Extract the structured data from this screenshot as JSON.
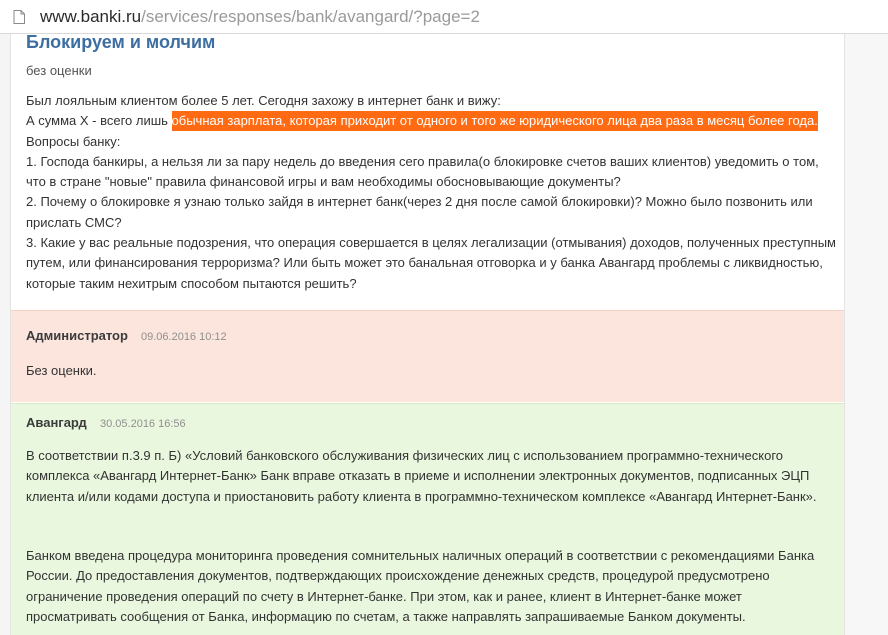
{
  "browser": {
    "url_host": "www.banki.ru",
    "url_path": "/services/responses/bank/avangard/?page=2"
  },
  "review": {
    "title": "Блокируем и молчим",
    "rating": "без оценки",
    "line1": "Был лояльным клиентом более 5 лет. Сегодня захожу в интернет банк и вижу:",
    "line2_pre": "А сумма X - всего лишь ",
    "line2_highlight": "обычная зарплата, которая приходит от одного и того же юридического лица два раза в месяц более года.",
    "line3": "Вопросы банку:",
    "q1": "1. Господа банкиры, а нельзя ли за пару недель до введения сего правила(о блокировке счетов ваших клиентов) уведомить о том, что в стране \"новые\" правила финансовой игры и вам необходимы обосновывающие документы?",
    "q2": "2. Почему о блокировке я узнаю только зайдя в интернет банк(через 2 дня после самой блокировки)? Можно было позвонить или прислать СМС?",
    "q3": "3. Какие у вас реальные подозрения, что операция совершается в целях легализации (отмывания) доходов, полученных преступным путем, или финансирования терроризма? Или быть может это банальная отговорка и у банка Авангард проблемы с ликвидностью, которые таким нехитрым способом пытаются решить?"
  },
  "responses": [
    {
      "author": "Администратор",
      "date": "09.06.2016 10:12",
      "text": "Без оценки."
    },
    {
      "author": "Авангард",
      "date": "30.05.2016 16:56",
      "para1": "В соответствии п.3.9 п. Б) «Условий банковского обслуживания физических лиц с использованием программно-технического комплекса «Авангард Интернет-Банк» Банк вправе отказать в приеме и исполнении электронных документов, подписанных ЭЦП клиента и/или кодами доступа и приостановить работу клиента в программно-техническом комплексе «Авангард Интернет-Банк».",
      "para2": "Банком введена процедура мониторинга проведения сомнительных наличных операций в соответствии с рекомендациями Банка России. До предоставления документов, подтверждающих происхождение денежных средств, процедурой предусмотрено ограничение проведения операций по счету в Интернет-банке. При этом, как и ранее, клиент в Интернет-банке может просматривать сообщения от Банка, информацию по счетам, а также направлять запрашиваемые Банком документы."
    }
  ],
  "colors": {
    "highlight": "#ff6a13",
    "admin_bg": "#fbe5dd",
    "bank_bg": "#eaf7df",
    "title": "#3d6ea0"
  },
  "icons": {
    "page": "page-icon"
  }
}
